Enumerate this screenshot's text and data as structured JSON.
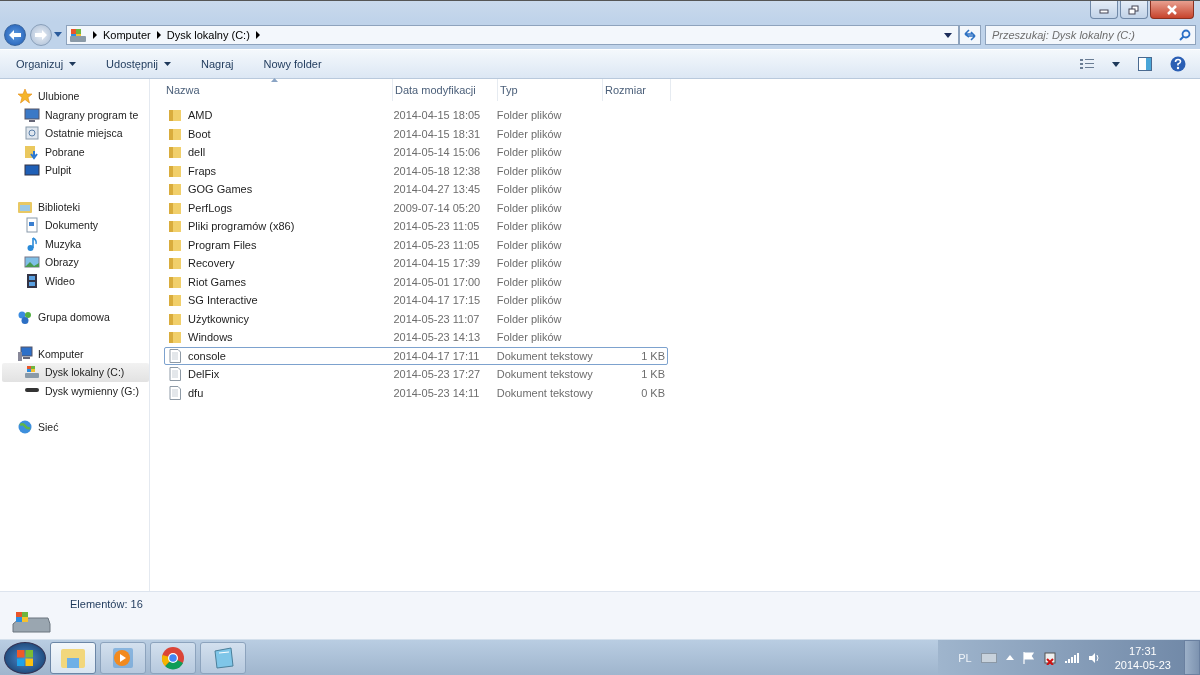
{
  "address": {
    "crumbs": [
      "Komputer",
      "Dysk lokalny (C:)"
    ]
  },
  "search": {
    "placeholder": "Przeszukaj: Dysk lokalny (C:)"
  },
  "toolbar": [
    {
      "label": "Organizuj",
      "dropdown": true
    },
    {
      "label": "Udostępnij",
      "dropdown": true
    },
    {
      "label": "Nagraj",
      "dropdown": false
    },
    {
      "label": "Nowy folder",
      "dropdown": false
    }
  ],
  "sidebar": {
    "groups": [
      {
        "label": "Ulubione",
        "kind": "star",
        "items": [
          {
            "label": "Nagrany program te",
            "kind": "monitor",
            "selected": false
          },
          {
            "label": "Ostatnie miejsca",
            "kind": "recent",
            "selected": false
          },
          {
            "label": "Pobrane",
            "kind": "download",
            "selected": false
          },
          {
            "label": "Pulpit",
            "kind": "desktop",
            "selected": false
          }
        ]
      },
      {
        "label": "Biblioteki",
        "kind": "library",
        "items": [
          {
            "label": "Dokumenty",
            "kind": "document",
            "selected": false
          },
          {
            "label": "Muzyka",
            "kind": "music",
            "selected": false
          },
          {
            "label": "Obrazy",
            "kind": "picture",
            "selected": false
          },
          {
            "label": "Wideo",
            "kind": "video",
            "selected": false
          }
        ]
      },
      {
        "label": "Grupa domowa",
        "kind": "homegroup"
      },
      {
        "label": "Komputer",
        "kind": "computer",
        "items": [
          {
            "label": "Dysk lokalny (C:)",
            "kind": "drive",
            "selected": true
          },
          {
            "label": "Dysk wymienny (G:)",
            "kind": "removable",
            "selected": false
          }
        ]
      },
      {
        "label": "Sieć",
        "kind": "network"
      }
    ]
  },
  "table": {
    "columns": [
      "Nazwa",
      "Data modyfikacji",
      "Typ",
      "Rozmiar"
    ],
    "rows": [
      {
        "name": "AMD",
        "date": "2014-04-15 18:05",
        "type": "Folder plików",
        "kind": "folder",
        "focused": false
      },
      {
        "name": "Boot",
        "date": "2014-04-15 18:31",
        "type": "Folder plików",
        "kind": "folder",
        "focused": false
      },
      {
        "name": "dell",
        "date": "2014-05-14 15:06",
        "type": "Folder plików",
        "kind": "folder",
        "focused": false
      },
      {
        "name": "Fraps",
        "date": "2014-05-18 12:38",
        "type": "Folder plików",
        "kind": "folder",
        "focused": false
      },
      {
        "name": "GOG Games",
        "date": "2014-04-27 13:45",
        "type": "Folder plików",
        "kind": "folder",
        "focused": false
      },
      {
        "name": "PerfLogs",
        "date": "2009-07-14 05:20",
        "type": "Folder plików",
        "kind": "folder",
        "focused": false
      },
      {
        "name": "Pliki programów (x86)",
        "date": "2014-05-23 11:05",
        "type": "Folder plików",
        "kind": "folder",
        "focused": false
      },
      {
        "name": "Program Files",
        "date": "2014-05-23 11:05",
        "type": "Folder plików",
        "kind": "folder",
        "focused": false
      },
      {
        "name": "Recovery",
        "date": "2014-04-15 17:39",
        "type": "Folder plików",
        "kind": "folder",
        "focused": false
      },
      {
        "name": "Riot Games",
        "date": "2014-05-01 17:00",
        "type": "Folder plików",
        "kind": "folder",
        "focused": false
      },
      {
        "name": "SG Interactive",
        "date": "2014-04-17 17:15",
        "type": "Folder plików",
        "kind": "folder",
        "focused": false
      },
      {
        "name": "Użytkownicy",
        "date": "2014-05-23 11:07",
        "type": "Folder plików",
        "kind": "folder",
        "focused": false
      },
      {
        "name": "Windows",
        "date": "2014-05-23 14:13",
        "type": "Folder plików",
        "kind": "folder",
        "focused": false
      },
      {
        "name": "console",
        "date": "2014-04-17 17:11",
        "type": "Dokument tekstowy",
        "size": "1 KB",
        "kind": "text",
        "focused": true
      },
      {
        "name": "DelFix",
        "date": "2014-05-23 17:27",
        "type": "Dokument tekstowy",
        "size": "1 KB",
        "kind": "text",
        "focused": false
      },
      {
        "name": "dfu",
        "date": "2014-05-23 14:11",
        "type": "Dokument tekstowy",
        "size": "0 KB",
        "kind": "text",
        "focused": false
      }
    ]
  },
  "details": {
    "text": "Elementów: 16"
  },
  "taskbar": {
    "buttons": [
      {
        "kind": "explorer",
        "active": true
      },
      {
        "kind": "media",
        "active": false
      },
      {
        "kind": "chrome",
        "active": false
      },
      {
        "kind": "notepad",
        "active": false
      }
    ],
    "tray": {
      "language": "PL",
      "time": "17:31",
      "date": "2014-05-23"
    }
  }
}
